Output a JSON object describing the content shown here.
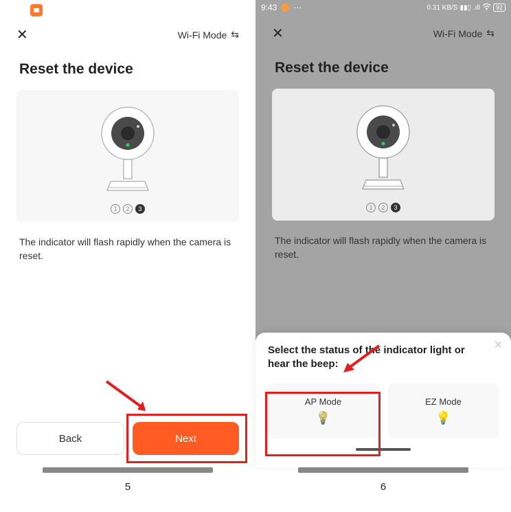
{
  "left": {
    "topbar": {
      "wifi_mode": "Wi-Fi Mode"
    },
    "heading": "Reset the device",
    "body_text": "The indicator will flash rapidly when the camera is reset.",
    "buttons": {
      "back": "Back",
      "next": "Next"
    },
    "step_label": "5"
  },
  "right": {
    "statusbar": {
      "time": "9:43",
      "net": "0.31 KB/S"
    },
    "topbar": {
      "wifi_mode": "Wi-Fi Mode"
    },
    "heading": "Reset the device",
    "body_text": "The indicator will flash rapidly when the camera is reset.",
    "sheet": {
      "title": "Select the status of the indicator light or hear the beep:",
      "mode_ap": "AP Mode",
      "mode_ez": "EZ Mode"
    },
    "step_label": "6"
  },
  "steps": {
    "s1": "1",
    "s2": "2",
    "s3": "3"
  }
}
